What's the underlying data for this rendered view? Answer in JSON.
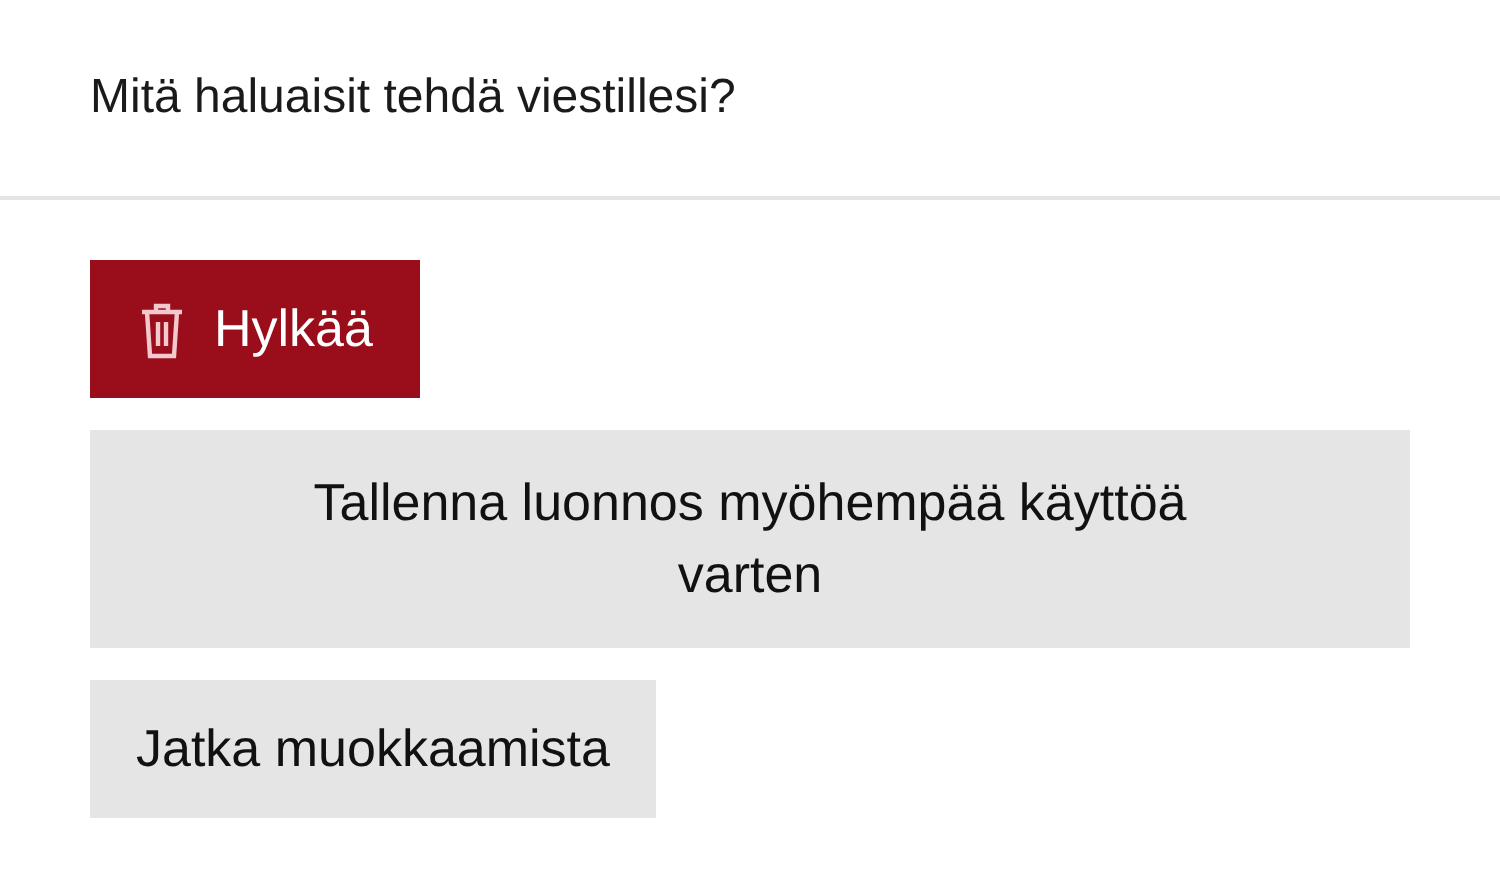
{
  "title": "Mitä haluaisit tehdä viestillesi?",
  "buttons": [
    {
      "label": "Hylkää",
      "kind": "danger"
    },
    {
      "label": "Tallenna luonnos myöhempää käyttöä varten",
      "kind": "wide"
    },
    {
      "label": "Jatka muokkaamista",
      "kind": "plain"
    }
  ]
}
